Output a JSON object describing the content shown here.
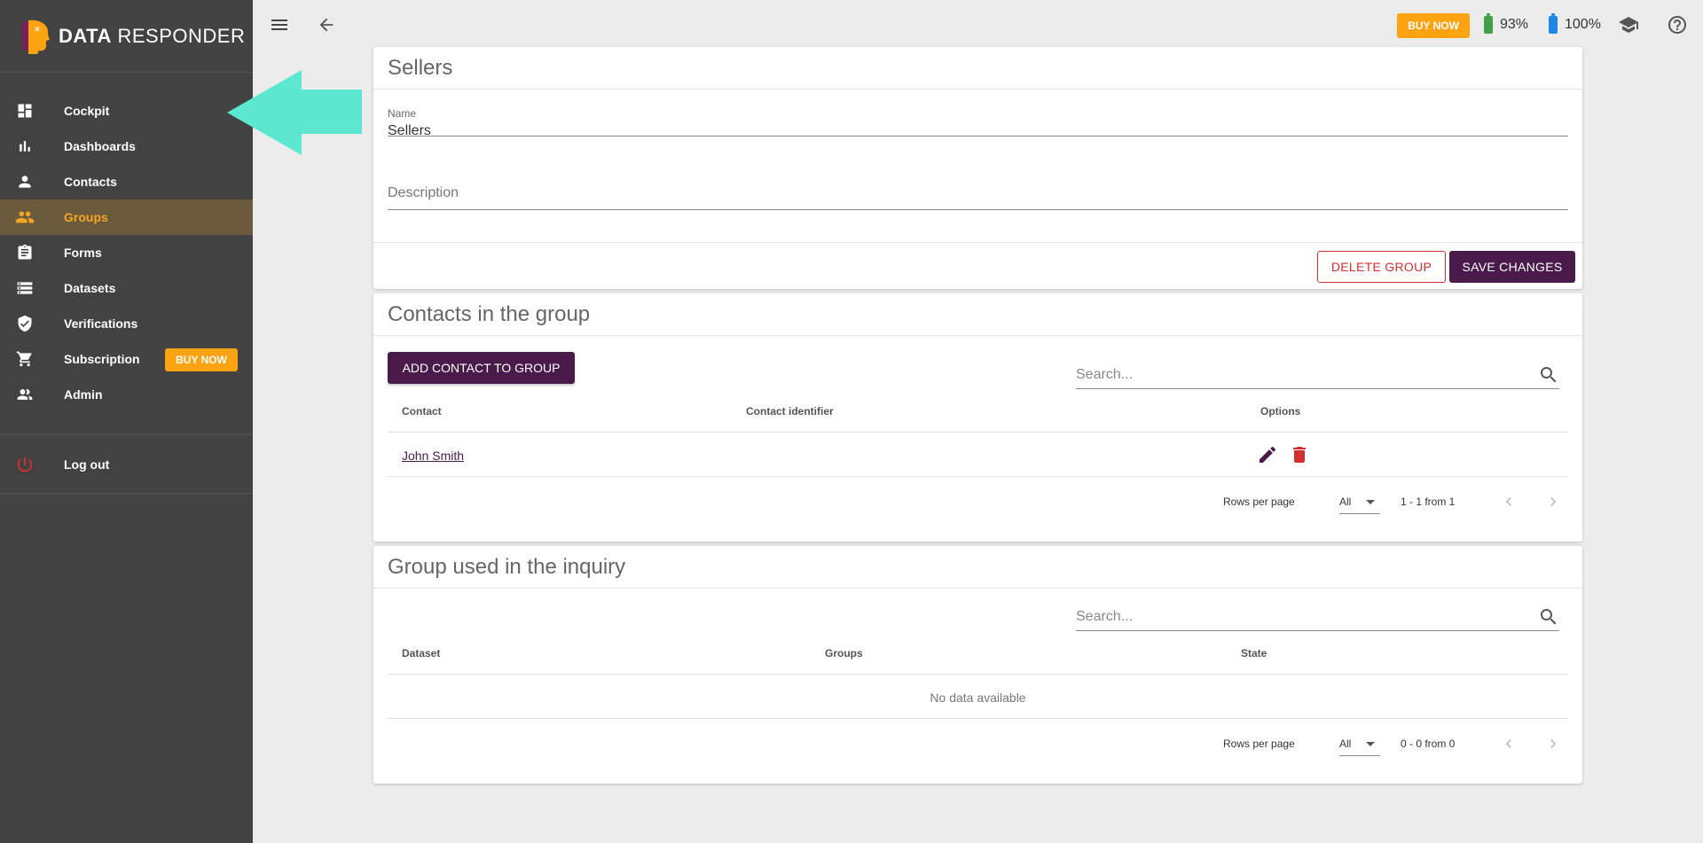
{
  "app": {
    "logo_bold": "DATA",
    "logo_rest": "RESPONDER"
  },
  "sidebar": {
    "items": [
      {
        "label": "Cockpit",
        "icon": "dashboard-icon"
      },
      {
        "label": "Dashboards",
        "icon": "bar-chart-icon"
      },
      {
        "label": "Contacts",
        "icon": "person-icon"
      },
      {
        "label": "Groups",
        "icon": "people-icon",
        "active": true
      },
      {
        "label": "Forms",
        "icon": "clipboard-icon"
      },
      {
        "label": "Datasets",
        "icon": "list-icon"
      },
      {
        "label": "Verifications",
        "icon": "shield-check-icon"
      },
      {
        "label": "Subscription",
        "icon": "cart-icon"
      },
      {
        "label": "Admin",
        "icon": "admin-people-icon"
      }
    ],
    "buy_now": "BUY NOW",
    "logout": "Log out"
  },
  "topbar": {
    "buy_now": "BUY NOW",
    "battery1": "93%",
    "battery2": "100%"
  },
  "group_card": {
    "title": "Sellers",
    "name_label": "Name",
    "name_value": "Sellers",
    "description_placeholder": "Description",
    "delete_label": "DELETE GROUP",
    "save_label": "SAVE CHANGES"
  },
  "contacts_card": {
    "title": "Contacts in the group",
    "add_label": "ADD CONTACT TO GROUP",
    "search_placeholder": "Search...",
    "columns": [
      "Contact",
      "Contact identifier",
      "Options"
    ],
    "rows": [
      {
        "contact": "John Smith",
        "identifier": ""
      }
    ],
    "rows_per_page_label": "Rows per page",
    "rows_per_page_value": "All",
    "range": "1 - 1 from 1"
  },
  "inquiry_card": {
    "title": "Group used in the inquiry",
    "search_placeholder": "Search...",
    "columns": [
      "Dataset",
      "Groups",
      "State"
    ],
    "no_data": "No data available",
    "rows_per_page_label": "Rows per page",
    "rows_per_page_value": "All",
    "range": "0 - 0 from 0"
  },
  "colors": {
    "sidebar_bg": "#424242",
    "active_bg": "#6b5a3b",
    "active_text": "#f5a623",
    "accent": "#fca311",
    "primary": "#4a1a4a",
    "danger": "#d32f2f",
    "arrow": "#5ce8d0",
    "battery_green": "#43a047",
    "battery_blue": "#1e88e5"
  }
}
